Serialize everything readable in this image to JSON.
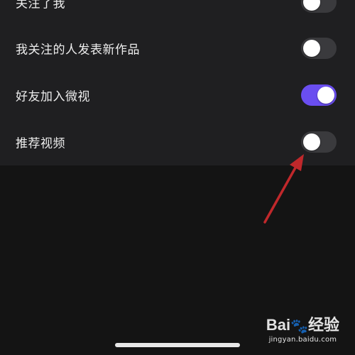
{
  "settings": {
    "items": [
      {
        "label": "关注了我",
        "enabled": false
      },
      {
        "label": "我关注的人发表新作品",
        "enabled": false
      },
      {
        "label": "好友加入微视",
        "enabled": true
      },
      {
        "label": "推荐视频",
        "enabled": false
      }
    ]
  },
  "watermark": {
    "brand_prefix": "Bai",
    "brand_suffix": "经验",
    "paw_icon": "paw-icon",
    "url": "jingyan.baidu.com"
  },
  "colors": {
    "panel_bg": "#1f1f21",
    "toggle_on": "#6a4ef0",
    "toggle_off": "#3a3a3d",
    "arrow": "#c0282b"
  }
}
